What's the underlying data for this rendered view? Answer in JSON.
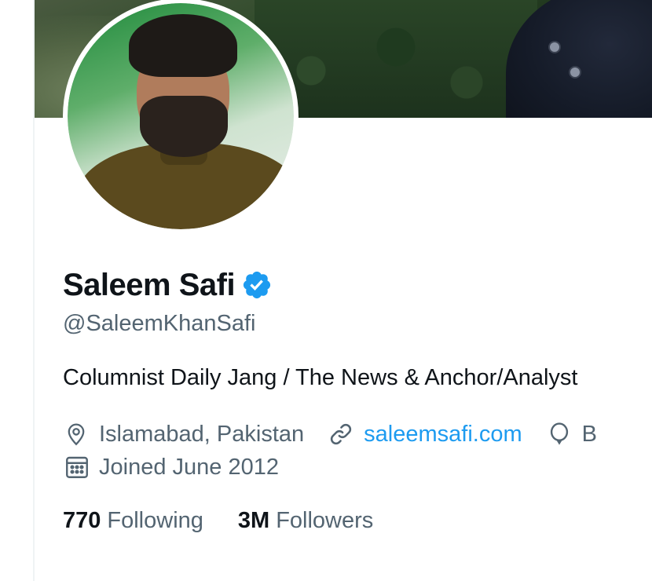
{
  "profile": {
    "name": "Saleem Safi",
    "handle": "@SaleemKhanSafi",
    "bio": "Columnist Daily Jang / The News & Anchor/Analyst",
    "location": "Islamabad, Pakistan",
    "website": "saleemsafi.com",
    "birthday_partial": "B",
    "joined": "Joined June 2012"
  },
  "stats": {
    "following_count": "770",
    "following_label": "Following",
    "followers_count": "3M",
    "followers_label": "Followers"
  },
  "icons": {
    "verified": "verified-badge-icon",
    "location": "location-pin-icon",
    "link": "link-icon",
    "birthday": "balloon-icon",
    "calendar": "calendar-icon"
  },
  "colors": {
    "accent": "#1d9bf0",
    "secondary_text": "#536471",
    "primary_text": "#0f1419"
  }
}
